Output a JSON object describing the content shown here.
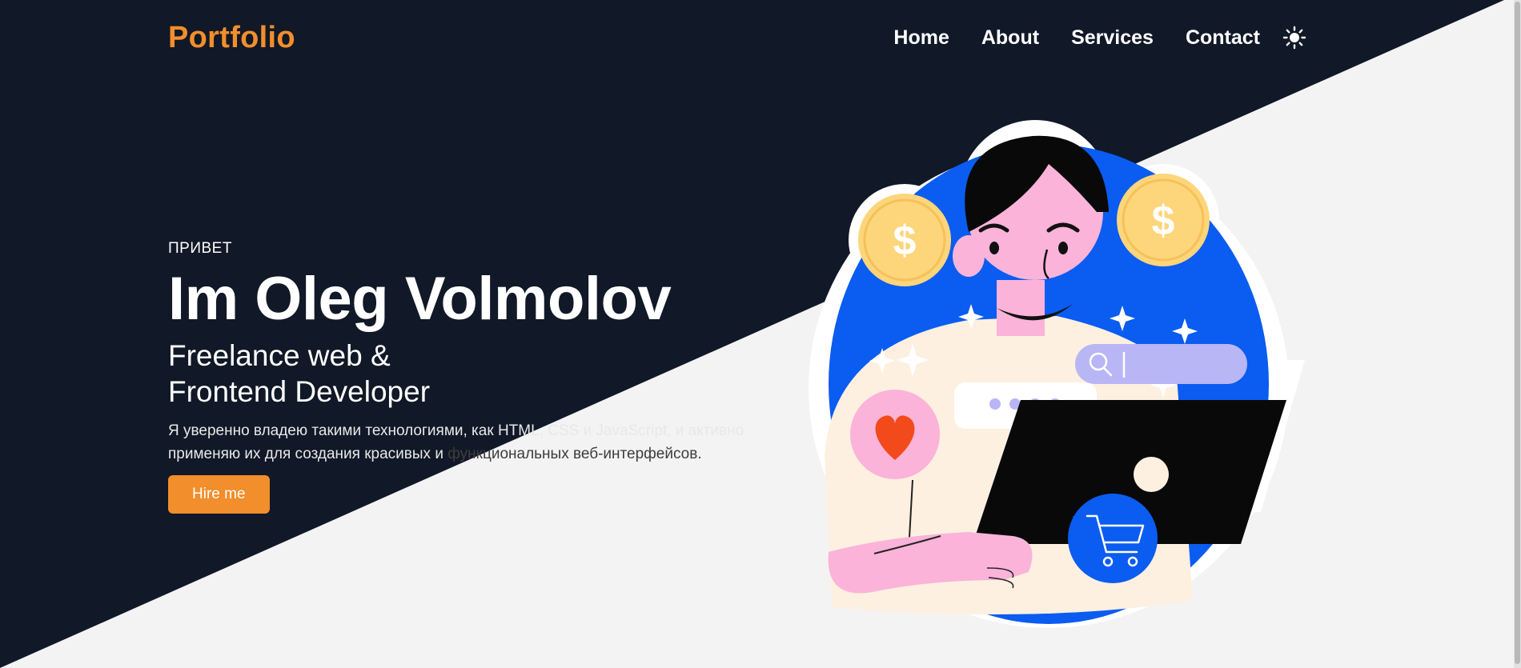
{
  "colors": {
    "dark_bg": "#111827",
    "light_bg": "#f3f3f3",
    "accent": "#f28e2b",
    "illustration_blue": "#0b5cf0",
    "skin_pink": "#fbb3d9",
    "coin_gold": "#fdd57a"
  },
  "header": {
    "logo": "Portfolio",
    "nav": [
      "Home",
      "About",
      "Services",
      "Contact"
    ],
    "theme_icon": "sun-icon"
  },
  "hero": {
    "greeting": "ПРИВЕТ",
    "name": "Im Oleg Volmolov",
    "role_line1": "Freelance web &",
    "role_line2": "Frontend Developer",
    "description_line1": "Я уверенно владею такими технологиями, как HTML, CSS и JavaScript, и активно",
    "description_line2_light": "применяю их для создания красивых и ",
    "description_line2_dark": "функциональных веб-интерфейсов.",
    "cta": "Hire me"
  },
  "illustration": {
    "icons": [
      "coin-dollar-icon",
      "heart-icon",
      "search-icon",
      "cart-icon",
      "sparkle-icon",
      "typing-dots-icon",
      "laptop-icon"
    ]
  }
}
